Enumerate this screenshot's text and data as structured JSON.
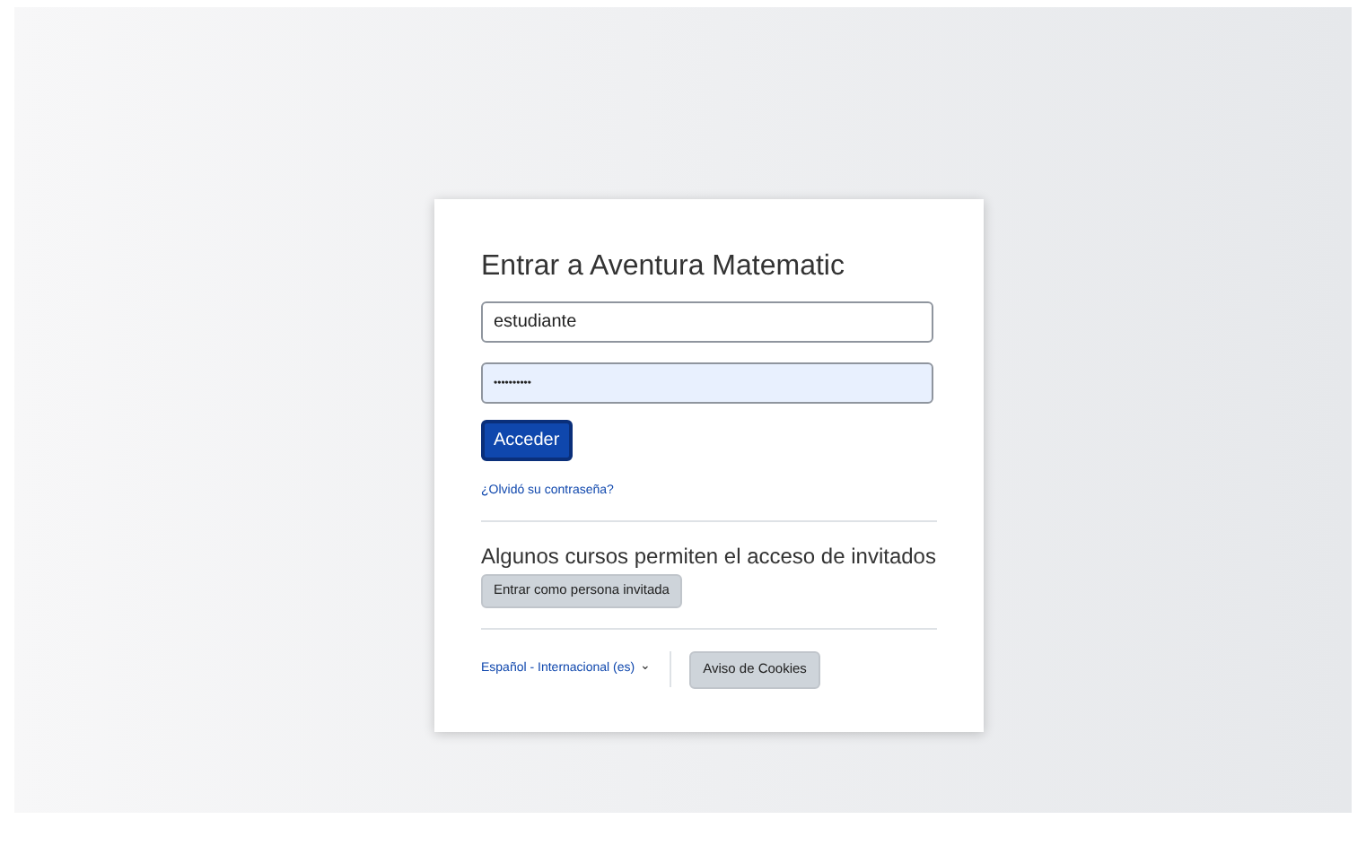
{
  "login": {
    "title": "Entrar a Aventura Matematic",
    "username": {
      "value": "estudiante"
    },
    "password": {
      "value": "••••••••••",
      "autofilled": true
    },
    "submit": "Acceder",
    "forgot_link": "¿Olvidó su contraseña?"
  },
  "guest": {
    "text": "Algunos cursos permiten el acceso de invitados",
    "button": "Entrar como persona invitada"
  },
  "footer": {
    "language": "Español - Internacional (es)",
    "language_caret": "⌄",
    "cookies_button": "Aviso de Cookies"
  }
}
